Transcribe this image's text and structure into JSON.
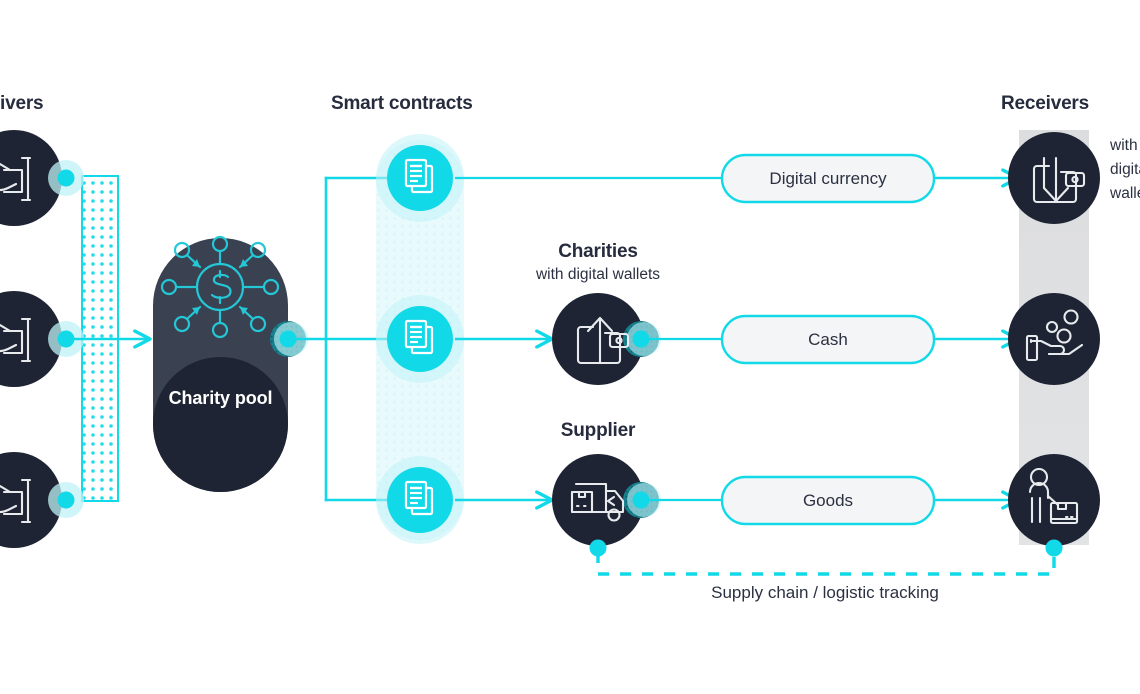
{
  "theme": {
    "cyan": "#12D9E8",
    "cyan_soft": "#BFF2F7",
    "cyan_halo": "#D9F7FA",
    "dark_circle": "#1E2433",
    "dark_pool": "#3A4150",
    "dark_pool_inner": "#1E2433",
    "band_gray": "#DEDFE1",
    "band_light": "#E8FAFC",
    "pill_fill": "#F4F5F6",
    "text_dark": "#262c3d",
    "page_bg": "#FFFFFF"
  },
  "columns": [
    {
      "id": "givers",
      "label": "ivers"
    },
    {
      "id": "smart-contracts",
      "label": "Smart contracts"
    },
    {
      "id": "receivers",
      "label": "Receivers"
    }
  ],
  "givers": {
    "heading": "ivers",
    "nodes": [
      {
        "icon": "hand-giving-money-icon"
      },
      {
        "icon": "hand-giving-money-icon"
      },
      {
        "icon": "hand-giving-money-icon"
      }
    ]
  },
  "pool": {
    "icon": "money-distribution-network-icon",
    "title_line1": "Charity",
    "title_line2": "pool"
  },
  "smart_contracts": {
    "heading": "Smart contracts",
    "nodes": [
      {
        "icon": "contract-documents-icon"
      },
      {
        "icon": "contract-documents-icon"
      },
      {
        "icon": "contract-documents-icon"
      }
    ]
  },
  "intermediaries": [
    {
      "id": "charities",
      "title": "Charities",
      "subtitle": "with digital wallets",
      "icon": "wallet-up-arrow-icon"
    },
    {
      "id": "supplier",
      "title": "Supplier",
      "subtitle": "",
      "icon": "delivery-truck-box-icon"
    }
  ],
  "flows": [
    {
      "id": "digital-currency",
      "label": "Digital currency"
    },
    {
      "id": "cash",
      "label": "Cash"
    },
    {
      "id": "goods",
      "label": "Goods"
    }
  ],
  "receivers": {
    "heading": "Receivers",
    "note": [
      "with",
      "digital",
      "wallets"
    ],
    "nodes": [
      {
        "icon": "wallet-down-arrow-icon"
      },
      {
        "icon": "hand-receiving-coins-icon"
      },
      {
        "icon": "person-with-box-icon"
      }
    ]
  },
  "tracking": {
    "label": "Supply chain / logistic tracking"
  }
}
